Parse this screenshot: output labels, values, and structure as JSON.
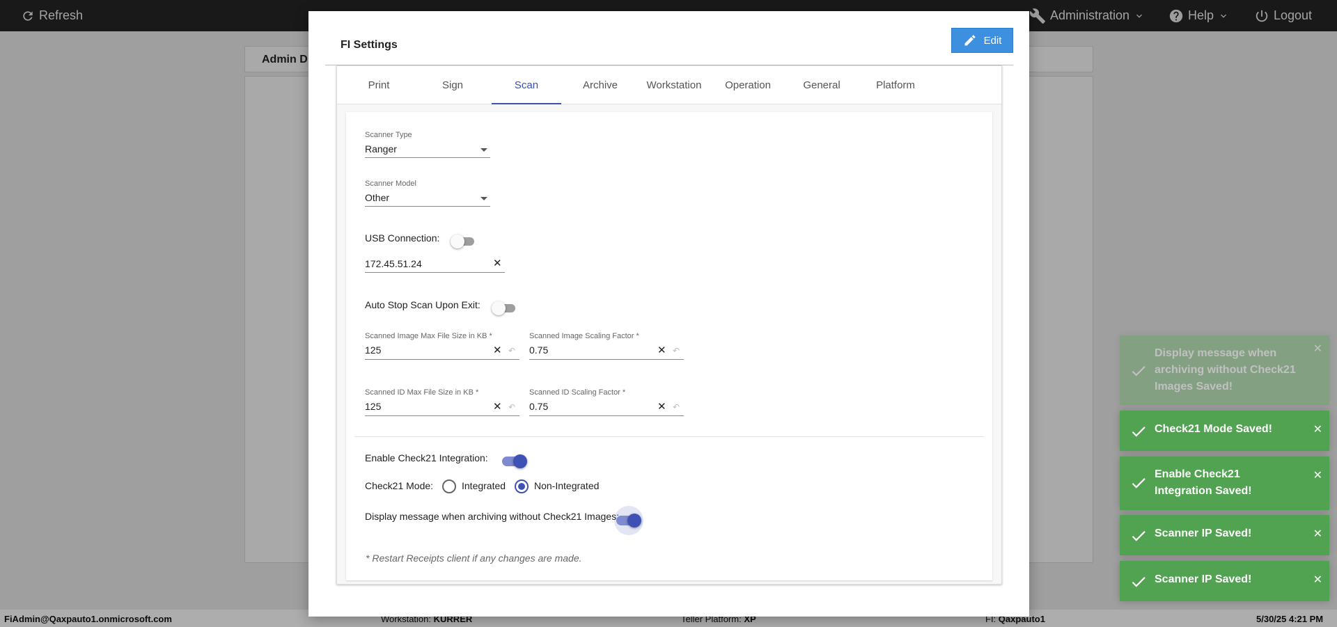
{
  "topbar": {
    "refresh_label": "Refresh",
    "administration_label": "Administration",
    "help_label": "Help",
    "logout_label": "Logout"
  },
  "background": {
    "header_title": "Admin D"
  },
  "statusbar": {
    "user": "FiAdmin@Qaxpauto1.onmicrosoft.com",
    "workstation_label": "Workstation:",
    "workstation_value": "KURRER",
    "teller_label": "Teller Platform:",
    "teller_value": "XP",
    "fi_label": "FI:",
    "fi_value": "Qaxpauto1",
    "datetime": "5/30/25 4:21 PM"
  },
  "modal": {
    "title": "FI Settings",
    "edit_label": "Edit",
    "tabs": [
      {
        "label": "Print"
      },
      {
        "label": "Sign"
      },
      {
        "label": "Scan"
      },
      {
        "label": "Archive"
      },
      {
        "label": "Workstation"
      },
      {
        "label": "Operation"
      },
      {
        "label": "General"
      },
      {
        "label": "Platform"
      }
    ],
    "active_tab": "Scan"
  },
  "scan": {
    "scanner_type_label": "Scanner Type",
    "scanner_type_value": "Ranger",
    "scanner_model_label": "Scanner Model",
    "scanner_model_value": "Other",
    "usb_connection_label": "USB Connection:",
    "usb_connection_on": false,
    "scanner_ip_value": "172.45.51.24",
    "auto_stop_label": "Auto Stop Scan Upon Exit:",
    "auto_stop_on": false,
    "image_max_size_label": "Scanned Image Max File Size in KB *",
    "image_max_size_value": "125",
    "image_scaling_label": "Scanned Image Scaling Factor *",
    "image_scaling_value": "0.75",
    "id_max_size_label": "Scanned ID Max File Size in KB *",
    "id_max_size_value": "125",
    "id_scaling_label": "Scanned ID Scaling Factor *",
    "id_scaling_value": "0.75",
    "check21_enable_label": "Enable Check21 Integration:",
    "check21_enable_on": true,
    "check21_mode_label": "Check21 Mode:",
    "check21_mode_options": [
      "Integrated",
      "Non-Integrated"
    ],
    "check21_mode_selected": "Non-Integrated",
    "display_msg_label": "Display message when archiving without Check21 Images:",
    "display_msg_on": true,
    "restart_note": "* Restart Receipts client if any changes are made."
  },
  "toasts": [
    {
      "text": "Display message when archiving without Check21 Images Saved!",
      "faded": true
    },
    {
      "text": "Check21 Mode Saved!",
      "faded": false
    },
    {
      "text": "Enable Check21 Integration Saved!",
      "faded": false
    },
    {
      "text": "Scanner IP Saved!",
      "faded": false
    },
    {
      "text": "Scanner IP Saved!",
      "faded": false
    }
  ],
  "colors": {
    "primary": "#3f51b5",
    "edit_button": "#3d8fe0",
    "toast_success": "#51a351",
    "topbar": "#262626"
  }
}
